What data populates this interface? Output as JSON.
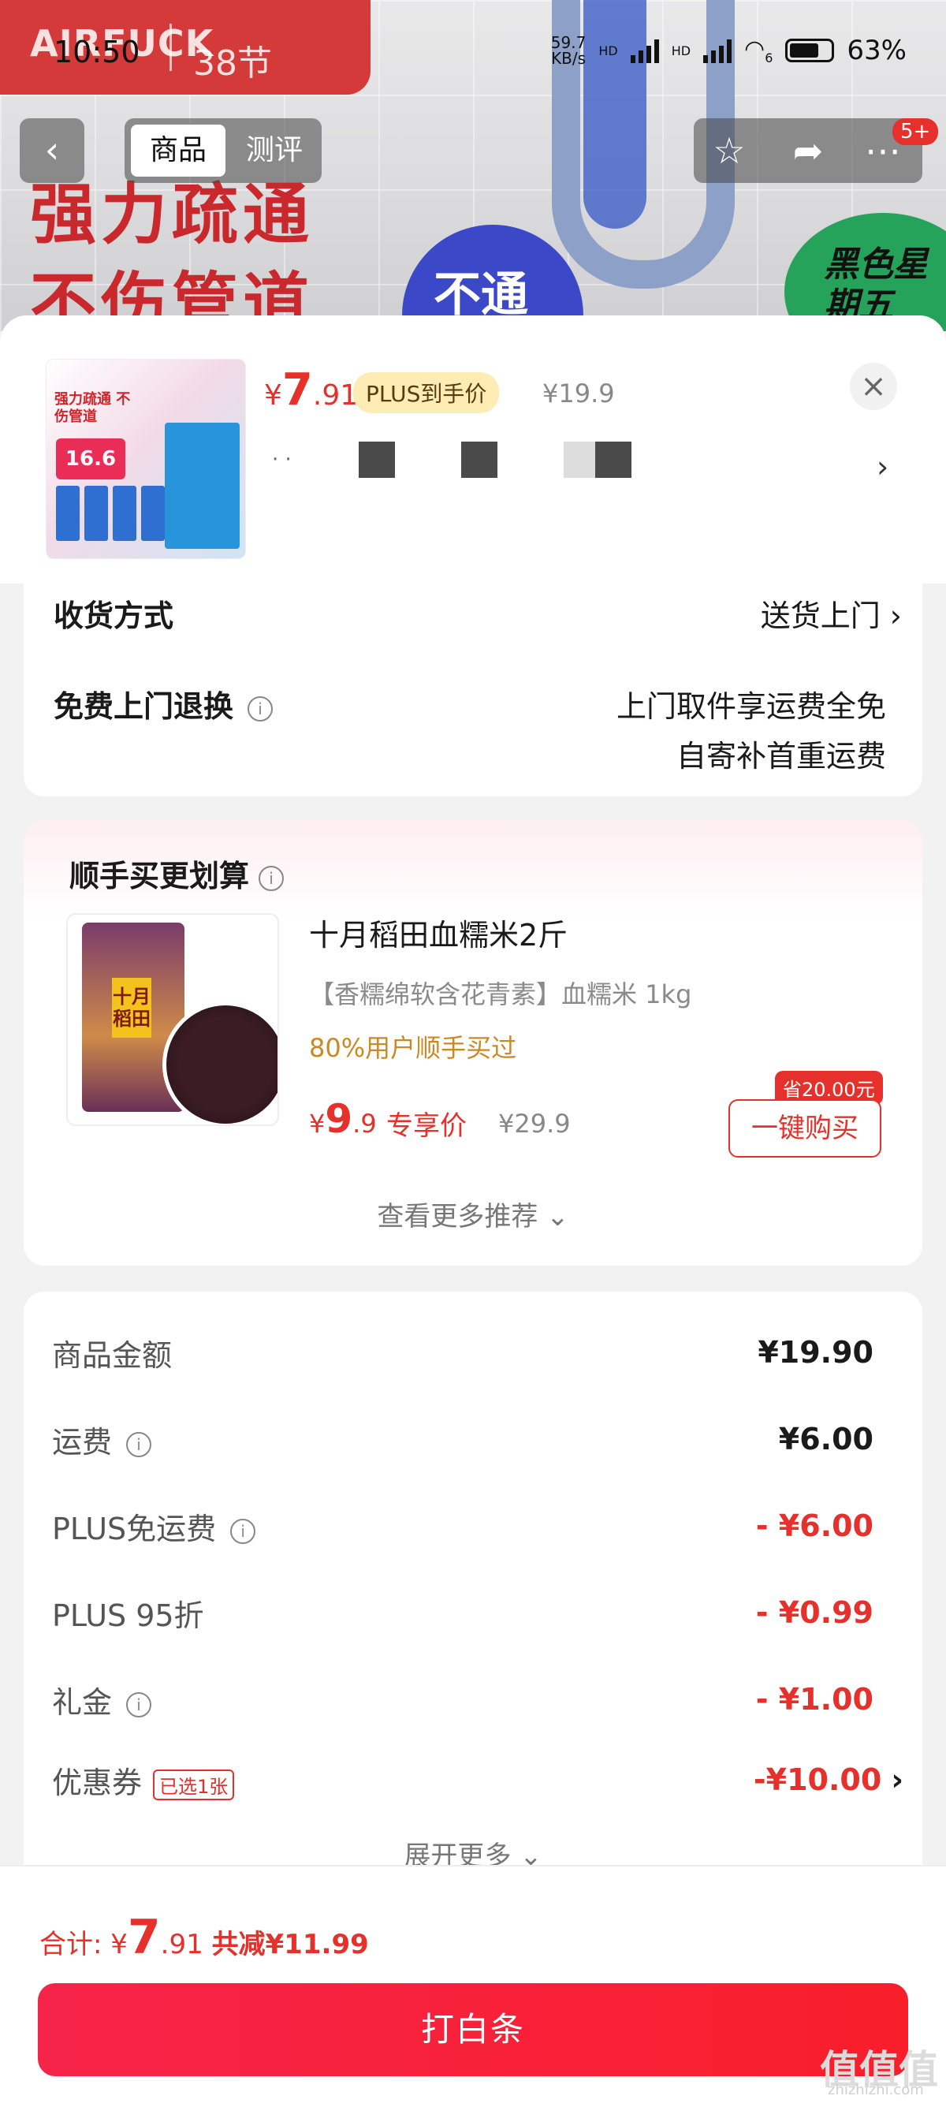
{
  "status_bar": {
    "time": "10:50",
    "speed": "59.7",
    "speed_unit": "KB/s",
    "battery": "63%",
    "hd1": "HD",
    "hd2": "HD",
    "wifi_num": "6"
  },
  "hero": {
    "brand": "AIRFUCK",
    "festival": "38节",
    "slogan_line1": "强力疏通",
    "slogan_line2": "不伤管道",
    "badge_blue": "不通",
    "badge_green": "黑色星期五"
  },
  "nav": {
    "tab_goods": "商品",
    "tab_review": "测评",
    "badge_count": "5+"
  },
  "product": {
    "price_symbol": "¥",
    "price_int": "7",
    "price_dec": ".91",
    "plus_label": "PLUS到手价",
    "original_price": "¥19.9",
    "spec_dots": "· ·",
    "thumb_text": "强力疏通 不伤管道",
    "thumb_price": "16.6",
    "chevron": "›",
    "close": "×"
  },
  "delivery": {
    "method_label": "收货方式",
    "method_value": "送货上门",
    "return_label": "免费上门退换",
    "return_line1": "上门取件享运费全免",
    "return_line2": "自寄补首重运费"
  },
  "recommend": {
    "title": "顺手买更划算",
    "item_name": "十月稻田血糯米2斤",
    "item_desc": "【香糯绵软含花青素】血糯米 1kg",
    "item_stat": "80%用户顺手买过",
    "price_symbol": "¥",
    "price_int": "9",
    "price_dec": ".9",
    "price_tag": "专享价",
    "orig_price": "¥29.9",
    "save_tag": "省20.00元",
    "buy_label": "一键购买",
    "bag_text": "十月稻田",
    "more": "查看更多推荐 ⌄"
  },
  "summary": {
    "rows": [
      {
        "label": "商品金额",
        "value": "¥19.90"
      },
      {
        "label": "运费",
        "value": "¥6.00"
      },
      {
        "label": "PLUS免运费",
        "value": "- ¥6.00"
      },
      {
        "label": "PLUS 95折",
        "value": "- ¥0.99"
      },
      {
        "label": "礼金",
        "value": "- ¥1.00"
      },
      {
        "label": "优惠券",
        "value": "-¥10.00",
        "tag": "已选1张"
      }
    ],
    "expand": "展开更多 ⌄"
  },
  "footer": {
    "total_label": "合计:",
    "total_symbol": "¥",
    "total_int": "7",
    "total_dec": ".91",
    "saved": "共减¥11.99",
    "pay_label": "打白条"
  },
  "watermark": {
    "main": "值值值",
    "sub": "zhizhizhi.com"
  },
  "colors": {
    "accent": "#e5302b",
    "plus_bg": "#fdecb3",
    "button": "#f81e2a"
  }
}
